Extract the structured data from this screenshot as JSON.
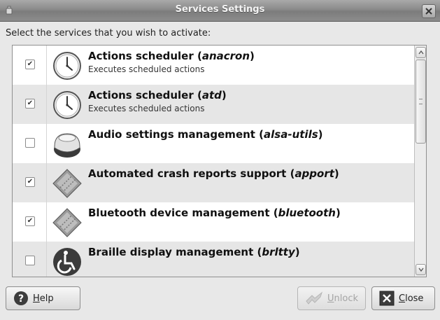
{
  "window": {
    "title": "Services Settings"
  },
  "instruction": "Select the services that you wish to activate:",
  "services": [
    {
      "name": "Actions scheduler (",
      "id": "anacron",
      "close": ")",
      "description": "Executes scheduled actions",
      "checked": true,
      "icon": "clock-icon"
    },
    {
      "name": "Actions scheduler (",
      "id": "atd",
      "close": ")",
      "description": "Executes scheduled actions",
      "checked": true,
      "icon": "clock-icon"
    },
    {
      "name": "Audio settings management (",
      "id": "alsa-utils",
      "close": ")",
      "description": "",
      "checked": false,
      "icon": "volume-knob-icon"
    },
    {
      "name": "Automated crash reports support (",
      "id": "apport",
      "close": ")",
      "description": "",
      "checked": true,
      "icon": "diamond-gear-icon"
    },
    {
      "name": "Bluetooth device management (",
      "id": "bluetooth",
      "close": ")",
      "description": "",
      "checked": true,
      "icon": "diamond-gear-icon"
    },
    {
      "name": "Braille display management (",
      "id": "brltty",
      "close": ")",
      "description": "",
      "checked": false,
      "icon": "accessibility-icon"
    }
  ],
  "buttons": {
    "help": {
      "first": "H",
      "rest": "elp"
    },
    "unlock": {
      "first": "U",
      "rest": "nlock"
    },
    "close": {
      "first": "C",
      "rest": "lose"
    }
  },
  "check_mark": "✔"
}
